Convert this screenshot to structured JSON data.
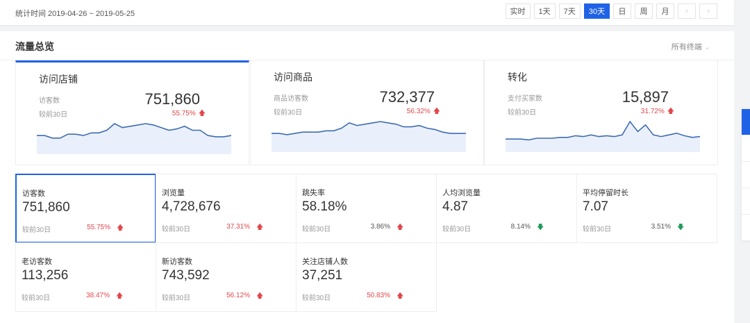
{
  "header": {
    "range_label": "统计时间 2019-04-26 ~ 2019-05-25",
    "buttons": [
      "实时",
      "1天",
      "7天",
      "30天",
      "日",
      "周",
      "月"
    ],
    "active": "30天"
  },
  "section": {
    "title": "流量总览",
    "filter": "所有终端"
  },
  "summary": [
    {
      "title": "访问店铺",
      "metric": "访客数",
      "compare": "较前30日",
      "value": "751,860",
      "pct": "55.75%",
      "spark": [
        10,
        10,
        8,
        8,
        11,
        11,
        10,
        12,
        12,
        14,
        19,
        16,
        17,
        18,
        19,
        18,
        16,
        14,
        15,
        17,
        14,
        14,
        10,
        9,
        9,
        10
      ]
    },
    {
      "title": "访问商品",
      "metric": "商品访客数",
      "compare": "较前30日",
      "value": "732,377",
      "pct": "56.32%",
      "spark": [
        10,
        10,
        9,
        10,
        11,
        11,
        11,
        12,
        12,
        14,
        18,
        16,
        17,
        18,
        19,
        18,
        17,
        15,
        15,
        16,
        14,
        13,
        11,
        10,
        10,
        10
      ]
    },
    {
      "title": "转化",
      "metric": "支付买家数",
      "compare": "较前30日",
      "value": "15,897",
      "pct": "31.72%",
      "spark": [
        9,
        9,
        9,
        8,
        10,
        10,
        10,
        11,
        11,
        13,
        12,
        14,
        12,
        13,
        12,
        14,
        30,
        18,
        26,
        14,
        12,
        14,
        16,
        13,
        11,
        12
      ]
    }
  ],
  "metrics": [
    {
      "name": "访客数",
      "value": "751,860",
      "compare": "较前30日",
      "pct": "55.75%",
      "dir": "up"
    },
    {
      "name": "浏览量",
      "value": "4,728,676",
      "compare": "较前30日",
      "pct": "37.31%",
      "dir": "up"
    },
    {
      "name": "跳失率",
      "value": "58.18%",
      "compare": "较前30日",
      "pct": "3.86%",
      "dir": "up"
    },
    {
      "name": "人均浏览量",
      "value": "4.87",
      "compare": "较前30日",
      "pct": "8.14%",
      "dir": "down"
    },
    {
      "name": "平均停留时长",
      "value": "7.07",
      "compare": "较前30日",
      "pct": "3.51%",
      "dir": "down"
    },
    {
      "name": "老访客数",
      "value": "113,256",
      "compare": "较前30日",
      "pct": "38.47%",
      "dir": "up"
    },
    {
      "name": "新访客数",
      "value": "743,592",
      "compare": "较前30日",
      "pct": "56.12%",
      "dir": "up"
    },
    {
      "name": "关注店铺人数",
      "value": "37,251",
      "compare": "较前30日",
      "pct": "50.83%",
      "dir": "up"
    }
  ],
  "colors": {
    "accent": "#2062e6",
    "up": "#e0474b",
    "down": "#1f9a5a"
  }
}
